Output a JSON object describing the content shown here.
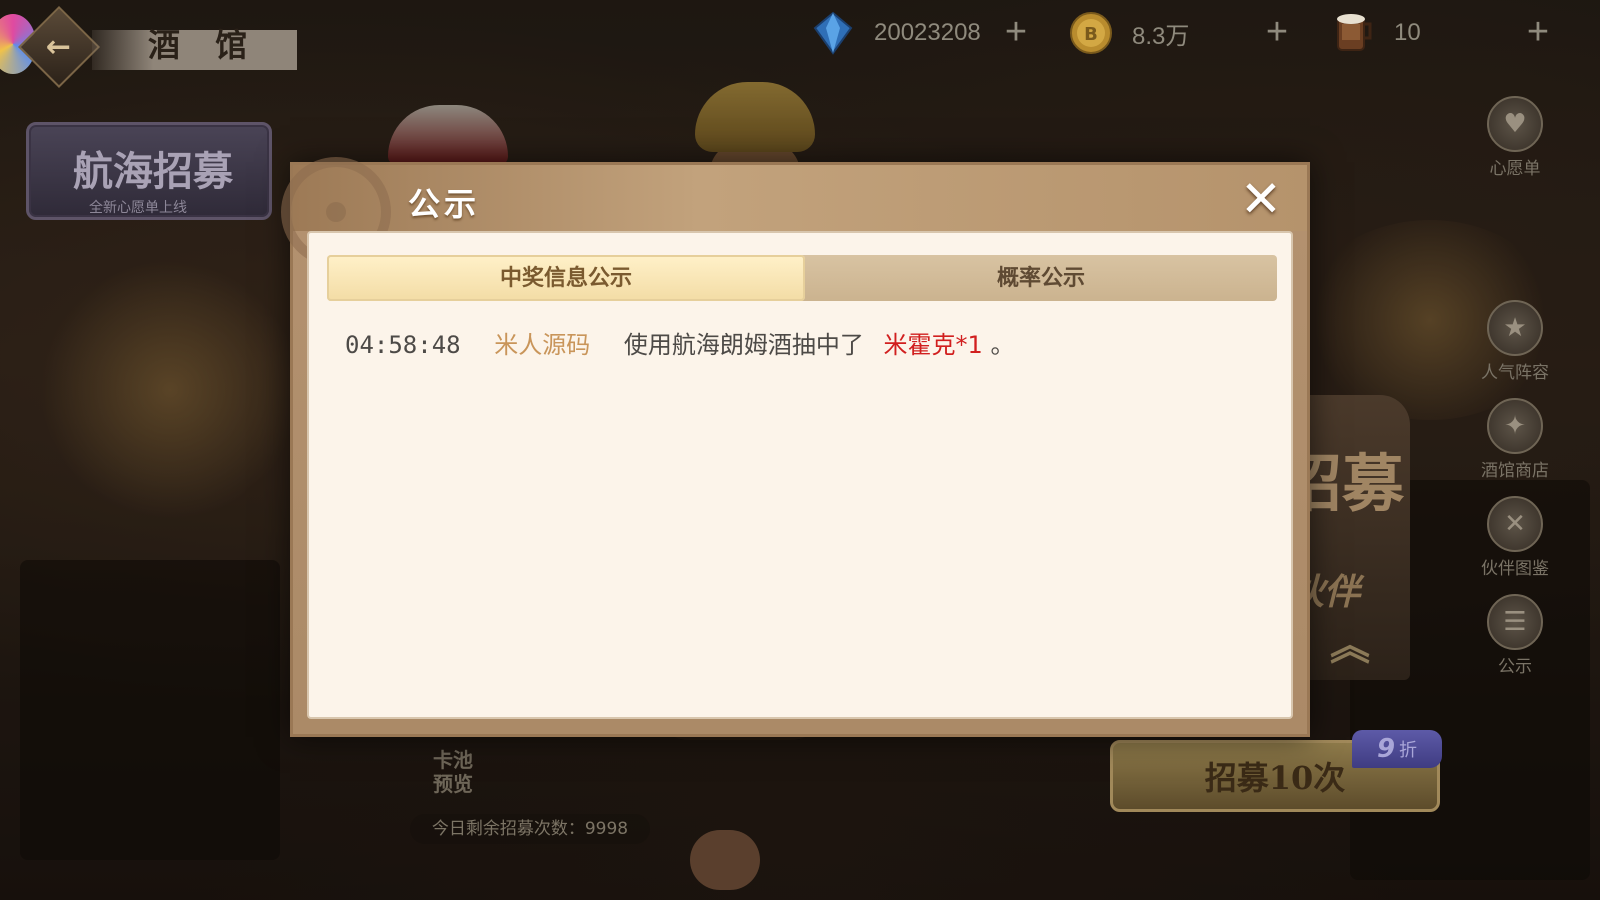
{
  "top_bar": {
    "title": "酒 馆",
    "diamonds": "20023208",
    "gold": "8.3万",
    "rum": "10"
  },
  "left": {
    "recruit_tab_title": "航海招募",
    "recruit_tab_subtitle": "全新心愿单上线",
    "pool_preview": [
      "卡池",
      "预览"
    ],
    "remaining": "今日剩余招募次数：9998"
  },
  "right": {
    "items": [
      {
        "label": "心愿单",
        "icon": "heart-icon"
      },
      {
        "label": "人气阵容",
        "icon": "star-flag-icon"
      },
      {
        "label": "酒馆商店",
        "icon": "shop-bag-icon"
      },
      {
        "label": "伙伴图鉴",
        "icon": "book-icon"
      },
      {
        "label": "公示",
        "icon": "list-icon"
      }
    ],
    "banner_big": "招募",
    "banner_partner": "伙伴",
    "recruit10_label": "招募10次",
    "discount_number": "9",
    "discount_unit": "折"
  },
  "modal": {
    "title": "公示",
    "close_glyph": "✕",
    "tabs": [
      "中奖信息公示",
      "概率公示"
    ],
    "active_tab": 0,
    "records": [
      {
        "time": "04:58:48",
        "player": "米人源码",
        "action": "使用航海朗姆酒抽中了",
        "prize": "米霍克*1",
        "end": "。"
      }
    ]
  },
  "colors": {
    "modal_bg": "#fcf4ea",
    "player": "#c9955a",
    "prize": "#d11f1f"
  }
}
